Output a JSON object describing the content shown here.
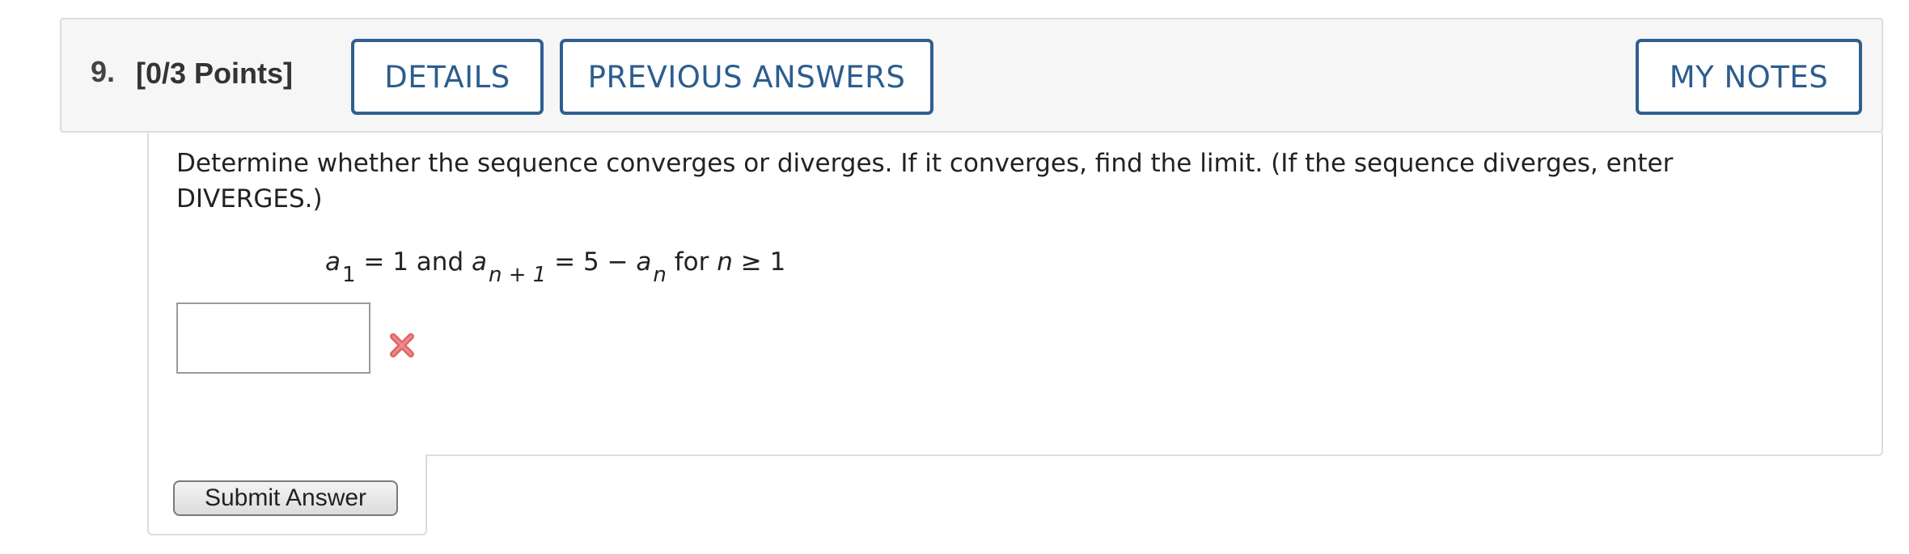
{
  "question": {
    "number": "9.",
    "points": "[0/3 Points]"
  },
  "header_buttons": {
    "details": "DETAILS",
    "previous_answers": "PREVIOUS ANSWERS",
    "my_notes": "MY NOTES"
  },
  "prompt": {
    "text": "Determine whether the sequence converges or diverges. If it converges, find the limit. (If the sequence diverges, enter DIVERGES.)"
  },
  "formula": {
    "a": "a",
    "sub_1": "1",
    "eq_one": " = 1 and ",
    "sub_n_plus_1": "n + 1",
    "eq_five_minus": " = 5 − ",
    "sub_n": "n",
    "for_text": " for ",
    "n": "n",
    "geq_one": " ≥ 1"
  },
  "answer": {
    "value": "",
    "status": "incorrect",
    "status_icon": "red-x-icon",
    "status_color": "#e06666"
  },
  "submit": {
    "label": "Submit Answer"
  },
  "colors": {
    "accent": "#2c5d8e",
    "header_bg": "#f6f6f6",
    "border": "#dcdcdc"
  }
}
